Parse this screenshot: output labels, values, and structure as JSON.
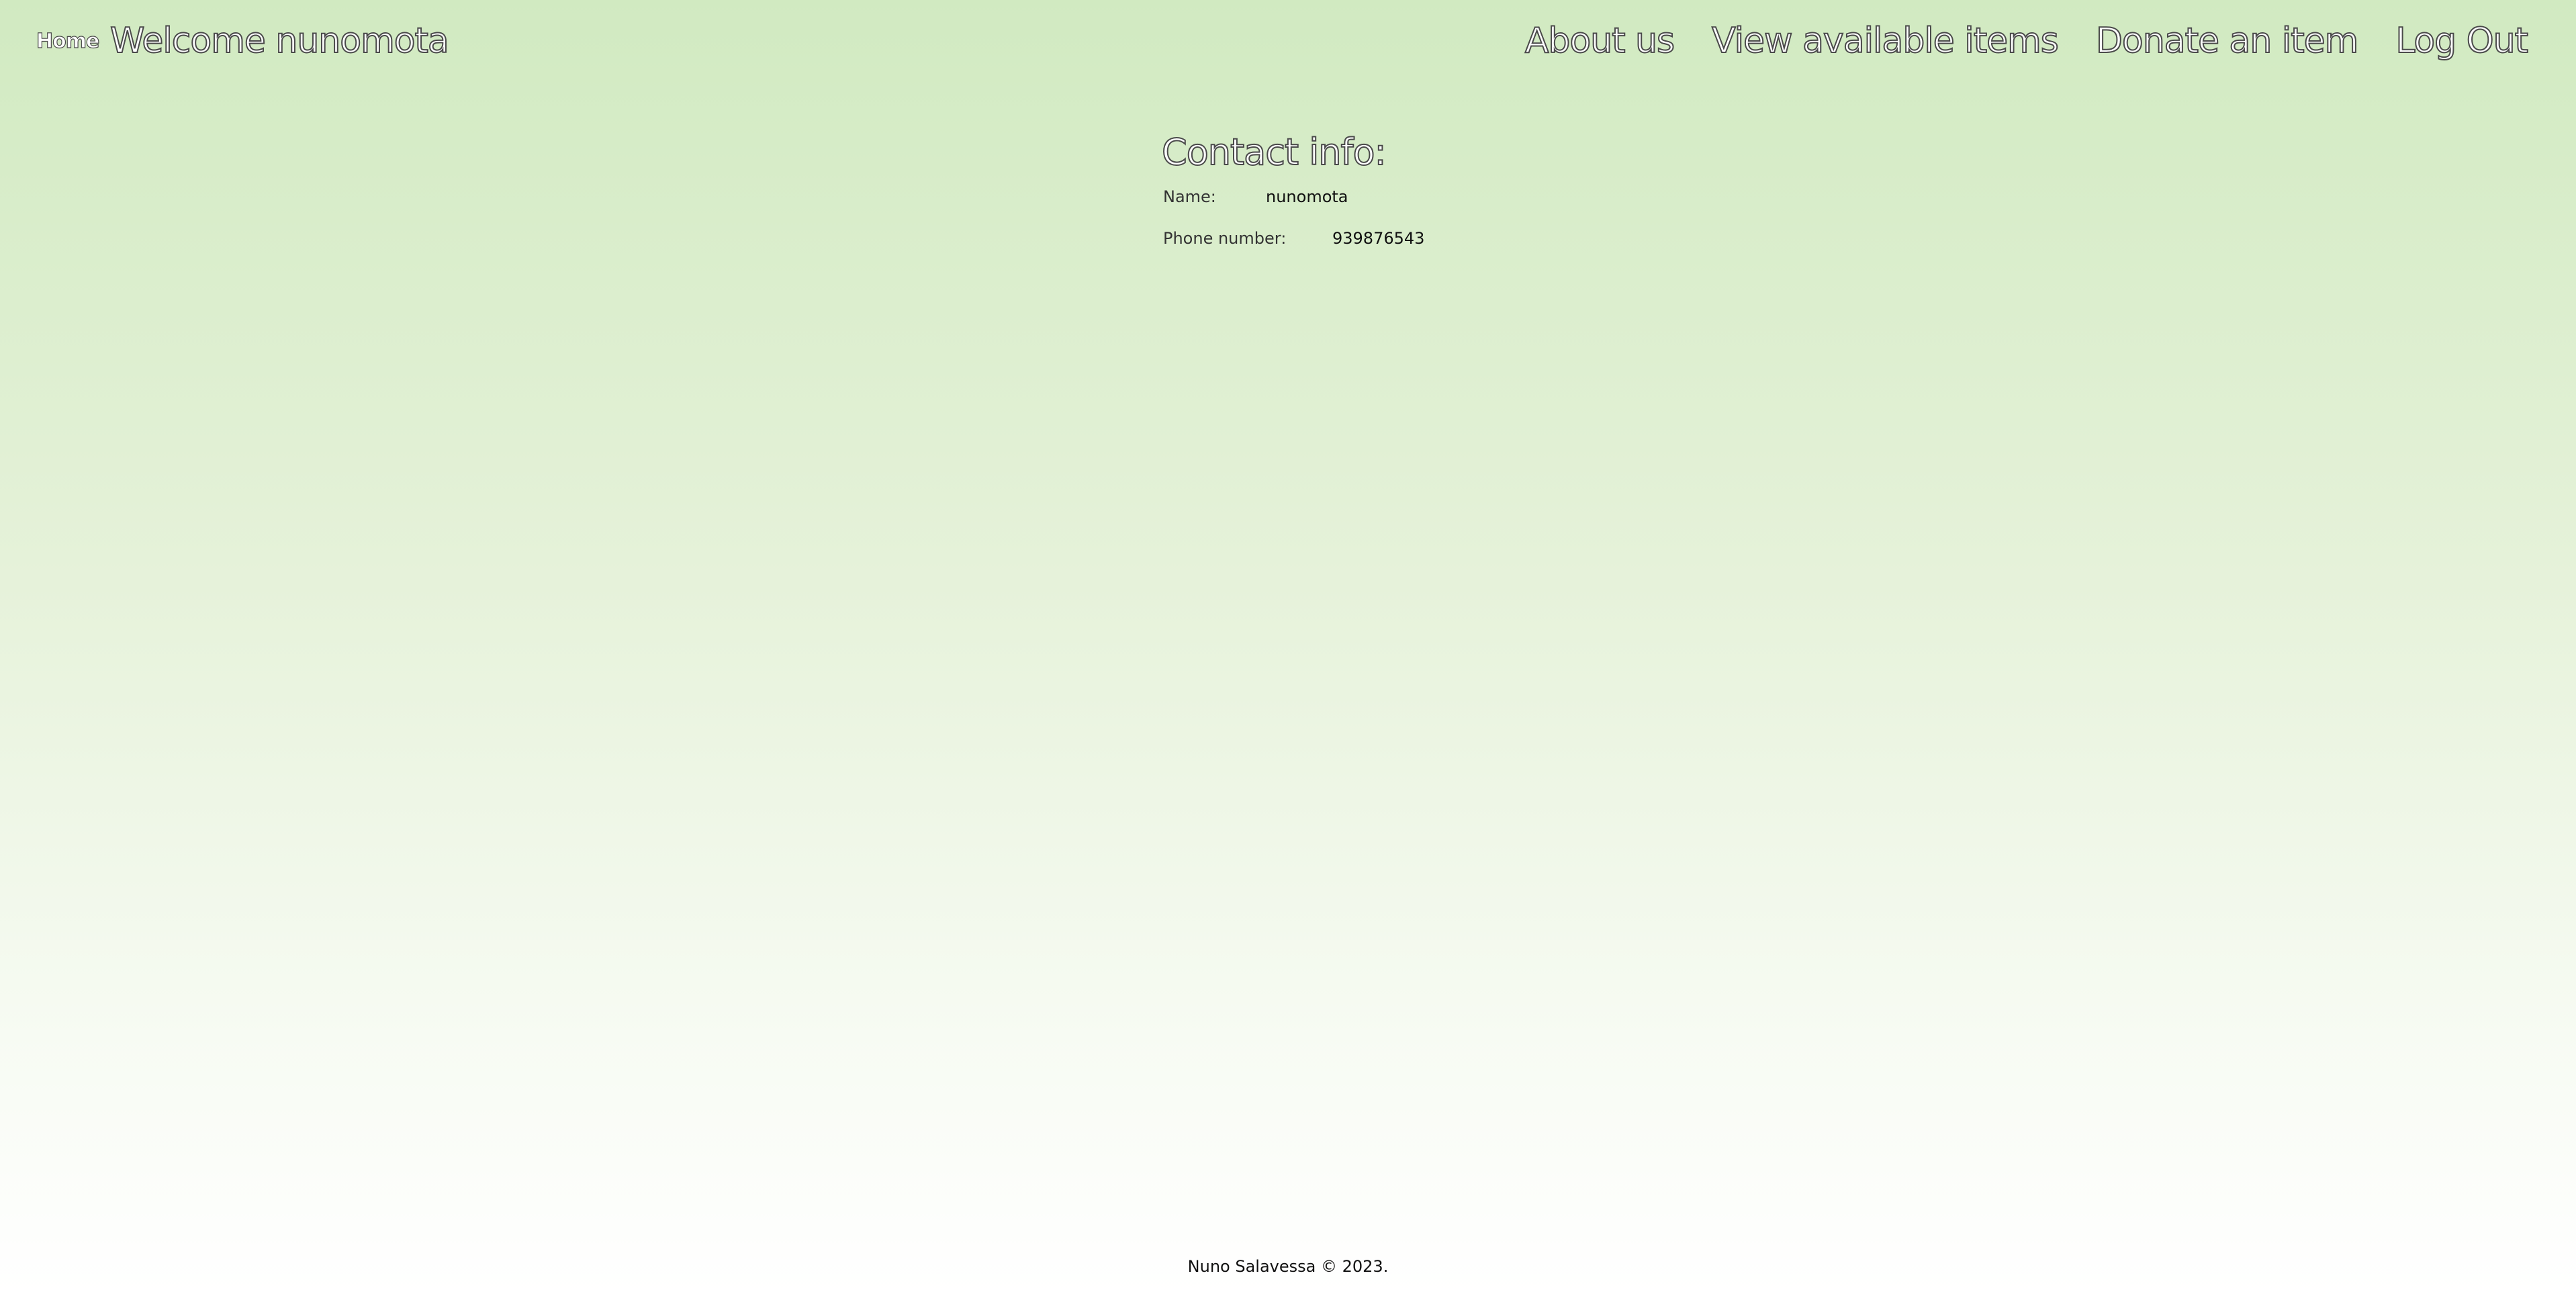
{
  "header": {
    "home_label": "Home",
    "welcome_text": "Welcome nunomota",
    "nav": [
      {
        "label": "About us"
      },
      {
        "label": "View available items"
      },
      {
        "label": "Donate an item"
      },
      {
        "label": "Log Out"
      }
    ]
  },
  "contact": {
    "title": "Contact info:",
    "name_label": "Name:",
    "name_value": "nunomota",
    "phone_label": "Phone number:",
    "phone_value": "939876543"
  },
  "footer": {
    "text": "Nuno Salavessa © 2023."
  },
  "colors": {
    "background_top": "#d1eac1",
    "background_bottom": "#ffffff",
    "text_outline": "#4a4a4a"
  }
}
